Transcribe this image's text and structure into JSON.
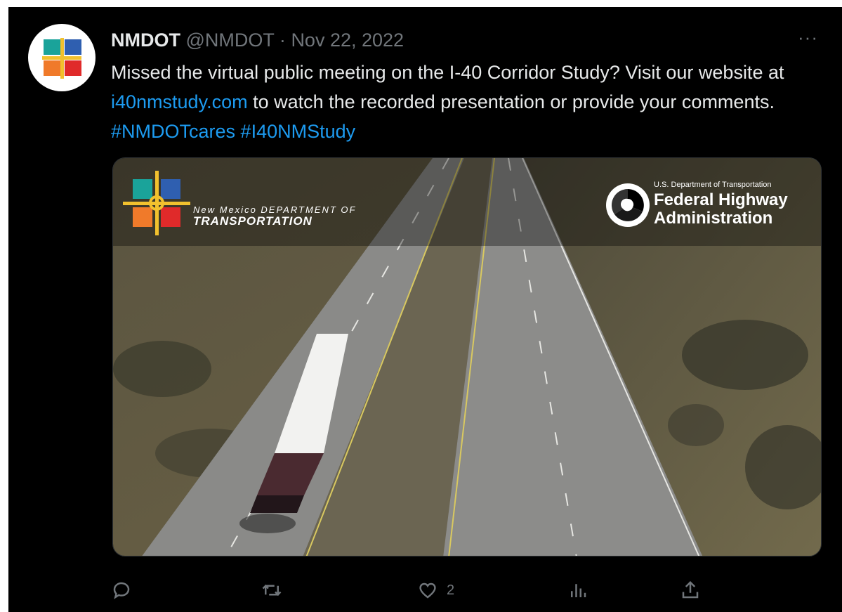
{
  "tweet": {
    "author_name": "NMDOT",
    "handle": "@NMDOT",
    "separator": "·",
    "date": "Nov 22, 2022",
    "more_icon": "more-horizontal-icon",
    "text_part1": "Missed the virtual public meeting on the I-40 Corridor Study? Visit our website at ",
    "link_url_text": "i40nmstudy.com",
    "text_part2": " to watch the recorded presentation or provide your comments. ",
    "hashtag1": "#NMDOTcares",
    "hashtag2": "#I40NMStudy"
  },
  "media": {
    "nm_logo_line1": "New Mexico DEPARTMENT OF",
    "nm_logo_line2": "TRANSPORTATION",
    "fhwa_dept": "U.S. Department of Transportation",
    "fhwa_line1": "Federal Highway",
    "fhwa_line2": "Administration"
  },
  "actions": {
    "reply_icon": "reply-icon",
    "retweet_icon": "retweet-icon",
    "like_icon": "heart-icon",
    "like_count": "2",
    "views_icon": "views-icon",
    "share_icon": "share-icon"
  },
  "colors": {
    "background": "#000000",
    "text": "#e7e9ea",
    "muted": "#71767b",
    "link": "#1d9bf0"
  }
}
